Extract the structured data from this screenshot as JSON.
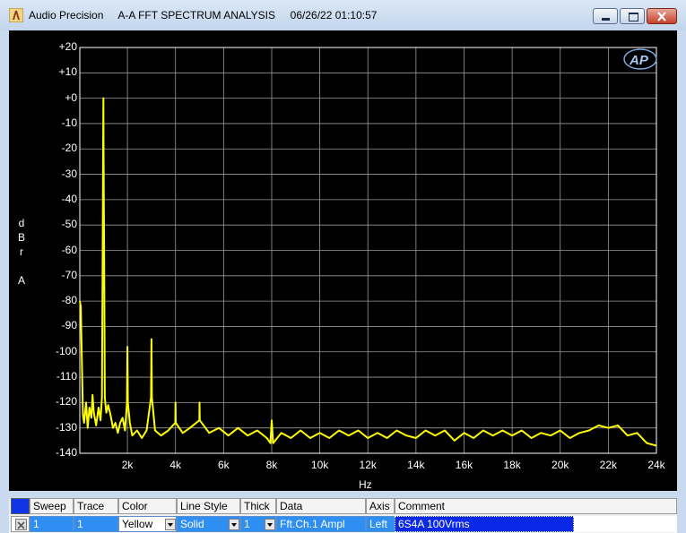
{
  "window": {
    "app_name": "Audio Precision",
    "title": "A-A FFT SPECTRUM ANALYSIS",
    "datetime": "06/26/22 01:10:57"
  },
  "logo_text": "AP",
  "chart_data": {
    "type": "line",
    "title": "",
    "xlabel": "Hz",
    "ylabel_lines": [
      "d",
      "B",
      "r",
      "",
      "A"
    ],
    "xlim": [
      20,
      24000
    ],
    "ylim": [
      -140,
      20
    ],
    "x_ticks": [
      {
        "v": 2000,
        "label": "2k"
      },
      {
        "v": 4000,
        "label": "4k"
      },
      {
        "v": 6000,
        "label": "6k"
      },
      {
        "v": 8000,
        "label": "8k"
      },
      {
        "v": 10000,
        "label": "10k"
      },
      {
        "v": 12000,
        "label": "12k"
      },
      {
        "v": 14000,
        "label": "14k"
      },
      {
        "v": 16000,
        "label": "16k"
      },
      {
        "v": 18000,
        "label": "18k"
      },
      {
        "v": 20000,
        "label": "20k"
      },
      {
        "v": 22000,
        "label": "22k"
      },
      {
        "v": 24000,
        "label": "24k"
      }
    ],
    "y_ticks": [
      {
        "v": 20,
        "label": "+20"
      },
      {
        "v": 10,
        "label": "+10"
      },
      {
        "v": 0,
        "label": "+0"
      },
      {
        "v": -10,
        "label": "-10"
      },
      {
        "v": -20,
        "label": "-20"
      },
      {
        "v": -30,
        "label": "-30"
      },
      {
        "v": -40,
        "label": "-40"
      },
      {
        "v": -50,
        "label": "-50"
      },
      {
        "v": -60,
        "label": "-60"
      },
      {
        "v": -70,
        "label": "-70"
      },
      {
        "v": -80,
        "label": "-80"
      },
      {
        "v": -90,
        "label": "-90"
      },
      {
        "v": -100,
        "label": "-100"
      },
      {
        "v": -110,
        "label": "-110"
      },
      {
        "v": -120,
        "label": "-120"
      },
      {
        "v": -130,
        "label": "-130"
      },
      {
        "v": -140,
        "label": "-140"
      }
    ],
    "grid": true,
    "series": [
      {
        "color": "#ffff00",
        "points": [
          [
            20,
            -80
          ],
          [
            60,
            -82
          ],
          [
            100,
            -100
          ],
          [
            150,
            -125
          ],
          [
            200,
            -128
          ],
          [
            280,
            -120
          ],
          [
            350,
            -130
          ],
          [
            420,
            -122
          ],
          [
            500,
            -126
          ],
          [
            550,
            -117
          ],
          [
            600,
            -124
          ],
          [
            700,
            -129
          ],
          [
            800,
            -122
          ],
          [
            880,
            -127
          ],
          [
            940,
            -118
          ],
          [
            970,
            -60
          ],
          [
            990,
            -20
          ],
          [
            1000,
            0
          ],
          [
            1010,
            -20
          ],
          [
            1030,
            -60
          ],
          [
            1060,
            -118
          ],
          [
            1120,
            -124
          ],
          [
            1200,
            -121
          ],
          [
            1300,
            -125
          ],
          [
            1400,
            -130
          ],
          [
            1500,
            -128
          ],
          [
            1600,
            -132
          ],
          [
            1700,
            -128
          ],
          [
            1800,
            -126
          ],
          [
            1900,
            -131
          ],
          [
            1980,
            -120
          ],
          [
            2000,
            -98
          ],
          [
            2020,
            -120
          ],
          [
            2100,
            -128
          ],
          [
            2200,
            -133
          ],
          [
            2400,
            -131
          ],
          [
            2600,
            -134
          ],
          [
            2800,
            -131
          ],
          [
            2980,
            -118
          ],
          [
            3000,
            -95
          ],
          [
            3020,
            -118
          ],
          [
            3150,
            -131
          ],
          [
            3400,
            -133
          ],
          [
            3700,
            -131
          ],
          [
            3990,
            -128
          ],
          [
            4000,
            -120
          ],
          [
            4010,
            -128
          ],
          [
            4300,
            -132
          ],
          [
            4600,
            -130
          ],
          [
            4990,
            -127
          ],
          [
            5000,
            -120
          ],
          [
            5010,
            -127
          ],
          [
            5400,
            -132
          ],
          [
            5800,
            -130
          ],
          [
            6200,
            -133
          ],
          [
            6600,
            -130
          ],
          [
            7000,
            -133
          ],
          [
            7400,
            -131
          ],
          [
            7800,
            -134
          ],
          [
            7950,
            -136
          ],
          [
            8000,
            -127
          ],
          [
            8060,
            -136
          ],
          [
            8400,
            -132
          ],
          [
            8800,
            -134
          ],
          [
            9200,
            -131
          ],
          [
            9600,
            -134
          ],
          [
            10000,
            -132
          ],
          [
            10400,
            -134
          ],
          [
            10800,
            -131
          ],
          [
            11200,
            -133
          ],
          [
            11600,
            -131
          ],
          [
            12000,
            -134
          ],
          [
            12400,
            -132
          ],
          [
            12800,
            -134
          ],
          [
            13200,
            -131
          ],
          [
            13600,
            -133
          ],
          [
            14000,
            -134
          ],
          [
            14400,
            -131
          ],
          [
            14800,
            -133
          ],
          [
            15200,
            -131
          ],
          [
            15600,
            -135
          ],
          [
            16000,
            -132
          ],
          [
            16400,
            -134
          ],
          [
            16800,
            -131
          ],
          [
            17200,
            -133
          ],
          [
            17600,
            -131
          ],
          [
            18000,
            -133
          ],
          [
            18400,
            -131
          ],
          [
            18800,
            -134
          ],
          [
            19200,
            -132
          ],
          [
            19600,
            -133
          ],
          [
            20000,
            -131
          ],
          [
            20400,
            -134
          ],
          [
            20800,
            -132
          ],
          [
            21200,
            -131
          ],
          [
            21600,
            -129
          ],
          [
            22000,
            -130
          ],
          [
            22400,
            -129
          ],
          [
            22800,
            -133
          ],
          [
            23200,
            -132
          ],
          [
            23600,
            -136
          ],
          [
            24000,
            -137
          ]
        ]
      }
    ]
  },
  "legend": {
    "headers": [
      "Sweep",
      "Trace",
      "Color",
      "Line Style",
      "Thick",
      "Data",
      "Axis",
      "Comment"
    ],
    "row": {
      "sweep": "1",
      "trace": "1",
      "color": "Yellow",
      "line_style": "Solid",
      "thick": "1",
      "data": "Fft.Ch.1 Ampl",
      "axis": "Left",
      "comment": "6S4A 100Vrms"
    }
  }
}
